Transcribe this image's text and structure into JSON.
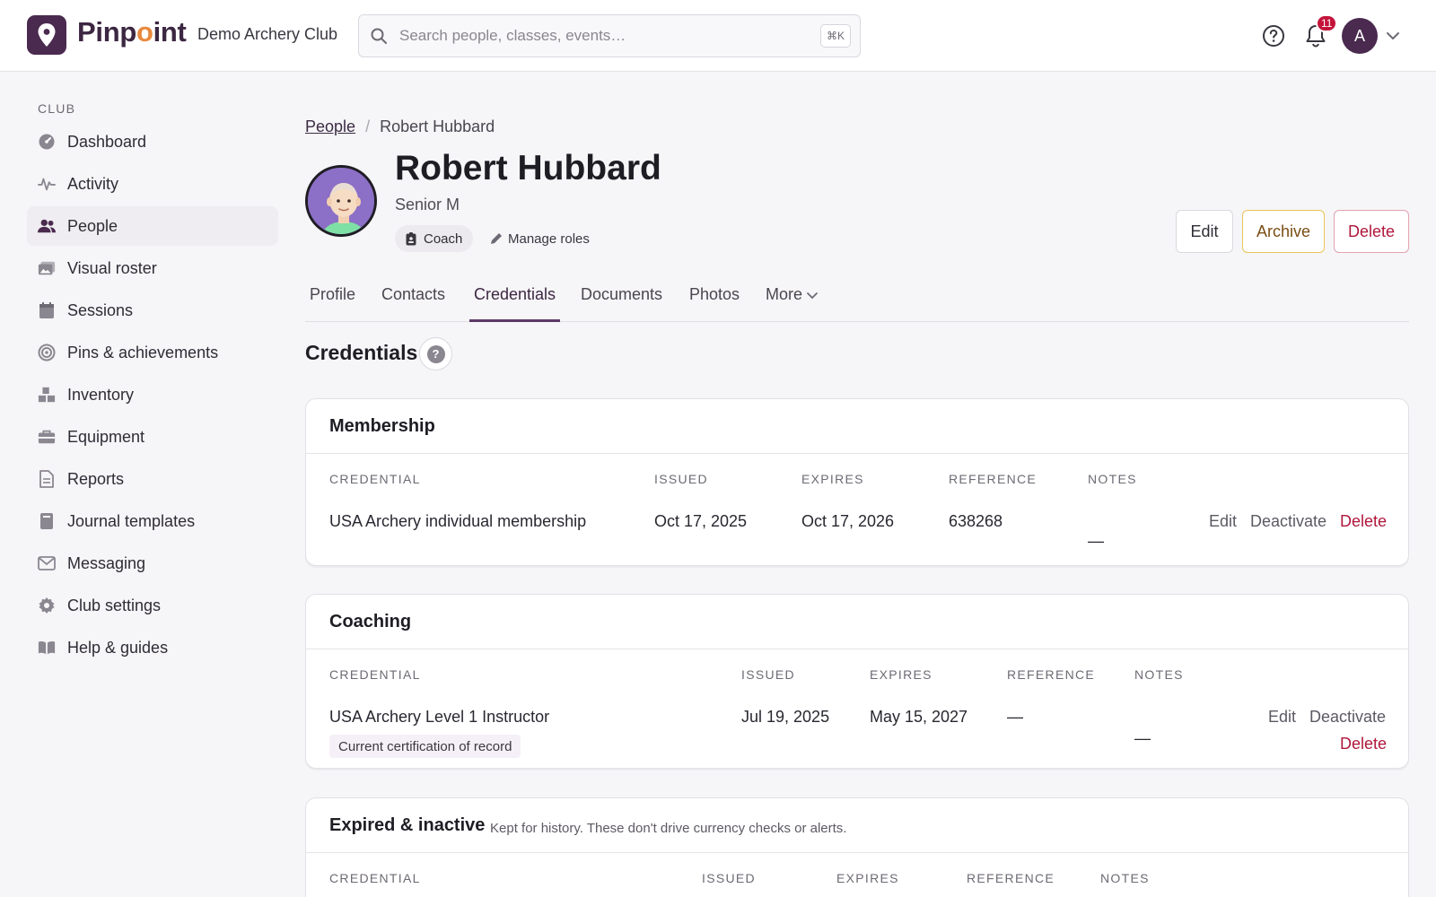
{
  "topbar": {
    "logo_text_a": "Pinp",
    "logo_text_o": "o",
    "logo_text_b": "int",
    "club_name": "Demo Archery Club",
    "search_placeholder": "Search people, classes, events…",
    "search_shortcut": "⌘K",
    "notification_count": "11",
    "avatar_initial": "A"
  },
  "sidebar": {
    "section_label": "CLUB",
    "items": [
      {
        "label": "Dashboard",
        "icon": "dashboard-icon"
      },
      {
        "label": "Activity",
        "icon": "activity-icon"
      },
      {
        "label": "People",
        "icon": "people-icon",
        "active": true
      },
      {
        "label": "Visual roster",
        "icon": "photos-icon"
      },
      {
        "label": "Sessions",
        "icon": "calendar-icon"
      },
      {
        "label": "Pins & achievements",
        "icon": "target-icon"
      },
      {
        "label": "Inventory",
        "icon": "boxes-icon"
      },
      {
        "label": "Equipment",
        "icon": "toolbox-icon"
      },
      {
        "label": "Reports",
        "icon": "document-icon"
      },
      {
        "label": "Journal templates",
        "icon": "journal-icon"
      },
      {
        "label": "Messaging",
        "icon": "envelope-icon"
      },
      {
        "label": "Club settings",
        "icon": "gear-icon"
      },
      {
        "label": "Help & guides",
        "icon": "book-icon"
      }
    ]
  },
  "breadcrumb": {
    "parent": "People",
    "separator": "/",
    "current": "Robert Hubbard"
  },
  "person": {
    "name": "Robert Hubbard",
    "subtitle": "Senior M",
    "role": "Coach",
    "manage_roles": "Manage roles"
  },
  "actions": {
    "edit": "Edit",
    "archive": "Archive",
    "delete": "Delete"
  },
  "tabs": [
    "Profile",
    "Contacts",
    "Credentials",
    "Documents",
    "Photos",
    "More"
  ],
  "active_tab": "Credentials",
  "section": {
    "title": "Credentials",
    "help": "?"
  },
  "columns": {
    "credential": "CREDENTIAL",
    "issued": "ISSUED",
    "expires": "EXPIRES",
    "reference": "REFERENCE",
    "notes": "NOTES"
  },
  "membership": {
    "title": "Membership",
    "row": {
      "credential": "USA Archery individual membership",
      "issued": "Oct 17, 2025",
      "expires": "Oct 17, 2026",
      "reference": "638268",
      "notes": "—",
      "edit": "Edit",
      "deactivate": "Deactivate",
      "delete": "Delete"
    }
  },
  "coaching": {
    "title": "Coaching",
    "row": {
      "credential": "USA Archery Level 1 Instructor",
      "tag": "Current certification of record",
      "issued": "Jul 19, 2025",
      "expires": "May 15, 2027",
      "reference": "—",
      "notes": "—",
      "edit": "Edit",
      "deactivate": "Deactivate",
      "delete": "Delete"
    }
  },
  "expired": {
    "title": "Expired & inactive",
    "subtitle": "Kept for history. These don't drive currency checks or alerts."
  },
  "colors": {
    "brand": "#4a2a4f",
    "accent_o": "#e8893e",
    "danger": "#b0173c",
    "archive_border": "#e8c55a"
  }
}
